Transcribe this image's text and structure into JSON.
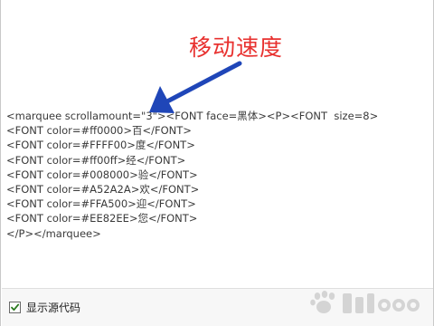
{
  "annotation": {
    "text": "移动速度",
    "color": "#e8312f"
  },
  "arrow": {
    "color": "#1f46b8"
  },
  "code": {
    "lines": [
      "<marquee scrollamount=\"3\"><FONT face=黑体><P><FONT  size=8>",
      "<FONT color=#ff0000>百</FONT>",
      "<FONT color=#FFFF00>度</FONT>",
      "<FONT color=#ff00ff>经</FONT>",
      "<FONT color=#008000>验</FONT>",
      "<FONT color=#A52A2A>欢</FONT>",
      "<FONT color=#FFA500>迎</FONT>",
      "<FONT color=#EE82EE>您</FONT>",
      "</P></marquee>"
    ]
  },
  "footer": {
    "show_source_label": "显示源代码",
    "show_source_checked": true
  },
  "watermark": {
    "icon": "baidu-paw-icon"
  }
}
